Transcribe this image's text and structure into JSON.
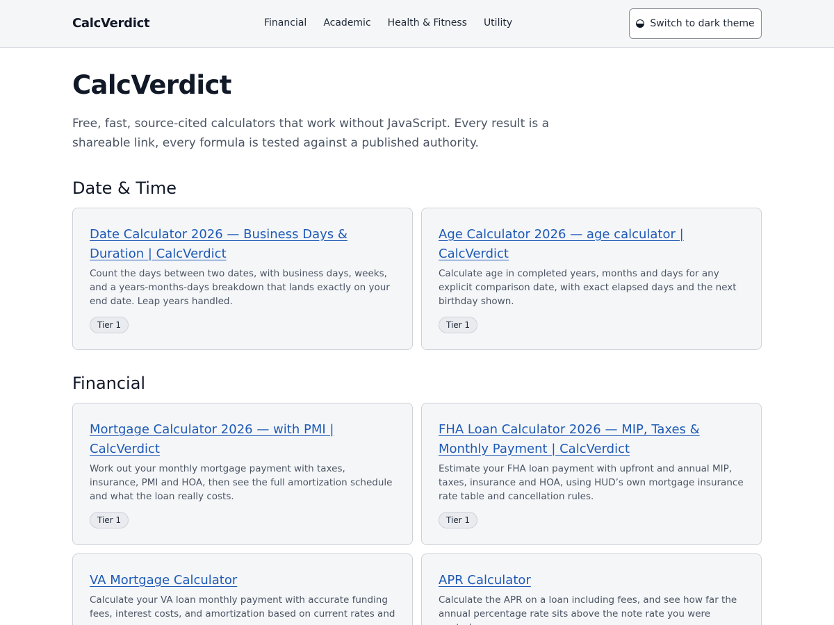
{
  "header": {
    "brand": "CalcVerdict",
    "nav": [
      "Financial",
      "Academic",
      "Health & Fitness",
      "Utility"
    ],
    "theme_button": "Switch to dark theme"
  },
  "hero": {
    "title": "CalcVerdict",
    "intro": "Free, fast, source-cited calculators that work without JavaScript. Every result is a shareable link, every formula is tested against a published authority."
  },
  "sections": [
    {
      "title": "Date & Time",
      "cards": [
        {
          "title": "Date Calculator 2026 — Business Days & Duration | CalcVerdict",
          "desc": "Count the days between two dates, with business days, weeks, and a years-months-days breakdown that lands exactly on your end date. Leap years handled.",
          "badge": "Tier 1"
        },
        {
          "title": "Age Calculator 2026 — age calculator | CalcVerdict",
          "desc": "Calculate age in completed years, months and days for any explicit comparison date, with exact elapsed days and the next birthday shown.",
          "badge": "Tier 1"
        }
      ]
    },
    {
      "title": "Financial",
      "cards": [
        {
          "title": "Mortgage Calculator 2026 — with PMI | CalcVerdict",
          "desc": "Work out your monthly mortgage payment with taxes, insurance, PMI and HOA, then see the full amortization schedule and what the loan really costs.",
          "badge": "Tier 1"
        },
        {
          "title": "FHA Loan Calculator 2026 — MIP, Taxes & Monthly Payment | CalcVerdict",
          "desc": "Estimate your FHA loan payment with upfront and annual MIP, taxes, insurance and HOA, using HUD’s own mortgage insurance rate table and cancellation rules.",
          "badge": "Tier 1"
        },
        {
          "title": "VA Mortgage Calculator",
          "desc": "Calculate your VA loan monthly payment with accurate funding fees, interest costs, and amortization based on current rates and"
        },
        {
          "title": "APR Calculator",
          "desc": "Calculate the APR on a loan including fees, and see how far the annual percentage rate sits above the note rate you were quoted."
        }
      ]
    }
  ]
}
